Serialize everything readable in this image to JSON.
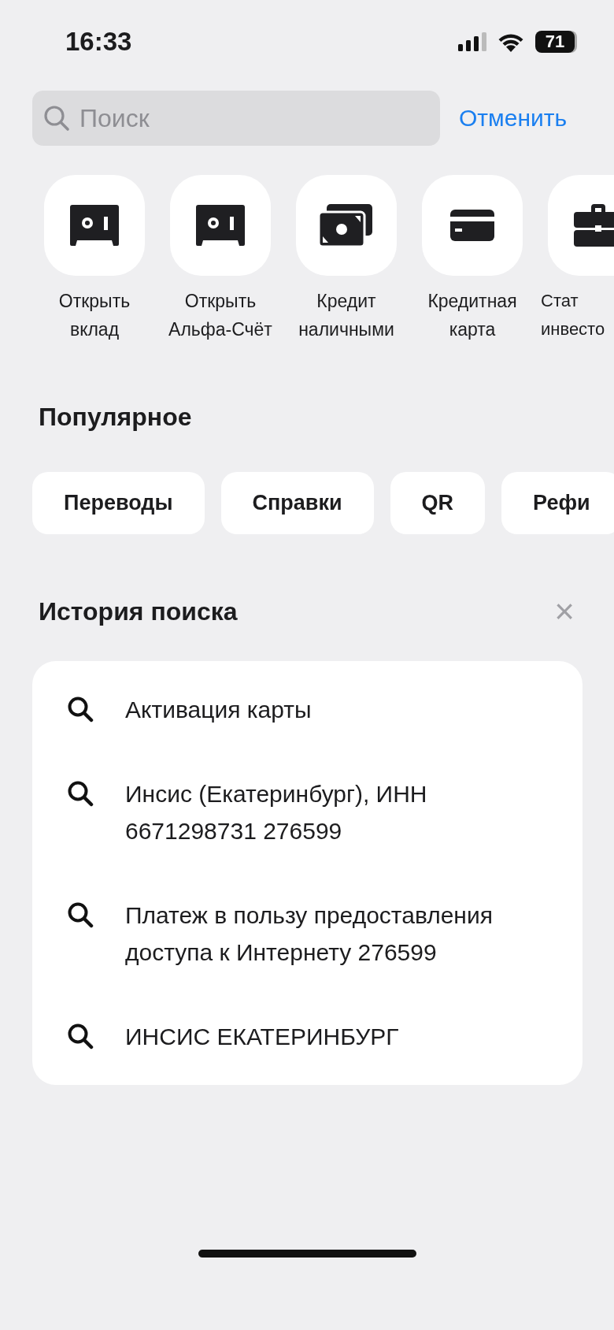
{
  "status_bar": {
    "time": "16:33",
    "battery": "71"
  },
  "search": {
    "placeholder": "Поиск",
    "cancel": "Отменить"
  },
  "quick_actions": [
    {
      "kind": "safe",
      "label": [
        "Открыть",
        "вклад"
      ]
    },
    {
      "kind": "safe",
      "label": [
        "Открыть",
        "Альфа-Счёт"
      ]
    },
    {
      "kind": "cash",
      "label": [
        "Кредит",
        "наличными"
      ]
    },
    {
      "kind": "card",
      "label": [
        "Кредитная",
        "карта"
      ]
    },
    {
      "kind": "briefcase",
      "label": [
        "Стат",
        "инвесто"
      ]
    }
  ],
  "popular": {
    "title": "Популярное",
    "chips": [
      "Переводы",
      "Справки",
      "QR",
      "Рефи"
    ]
  },
  "history": {
    "title": "История поиска",
    "clear": "×",
    "items": [
      "Активация карты",
      "Инсис (Екатеринбург), ИНН 6671298731 276599",
      "Платеж в пользу предоставления доступа к Интернету 276599",
      "ИНСИС ЕКАТЕРИНБУРГ"
    ]
  }
}
